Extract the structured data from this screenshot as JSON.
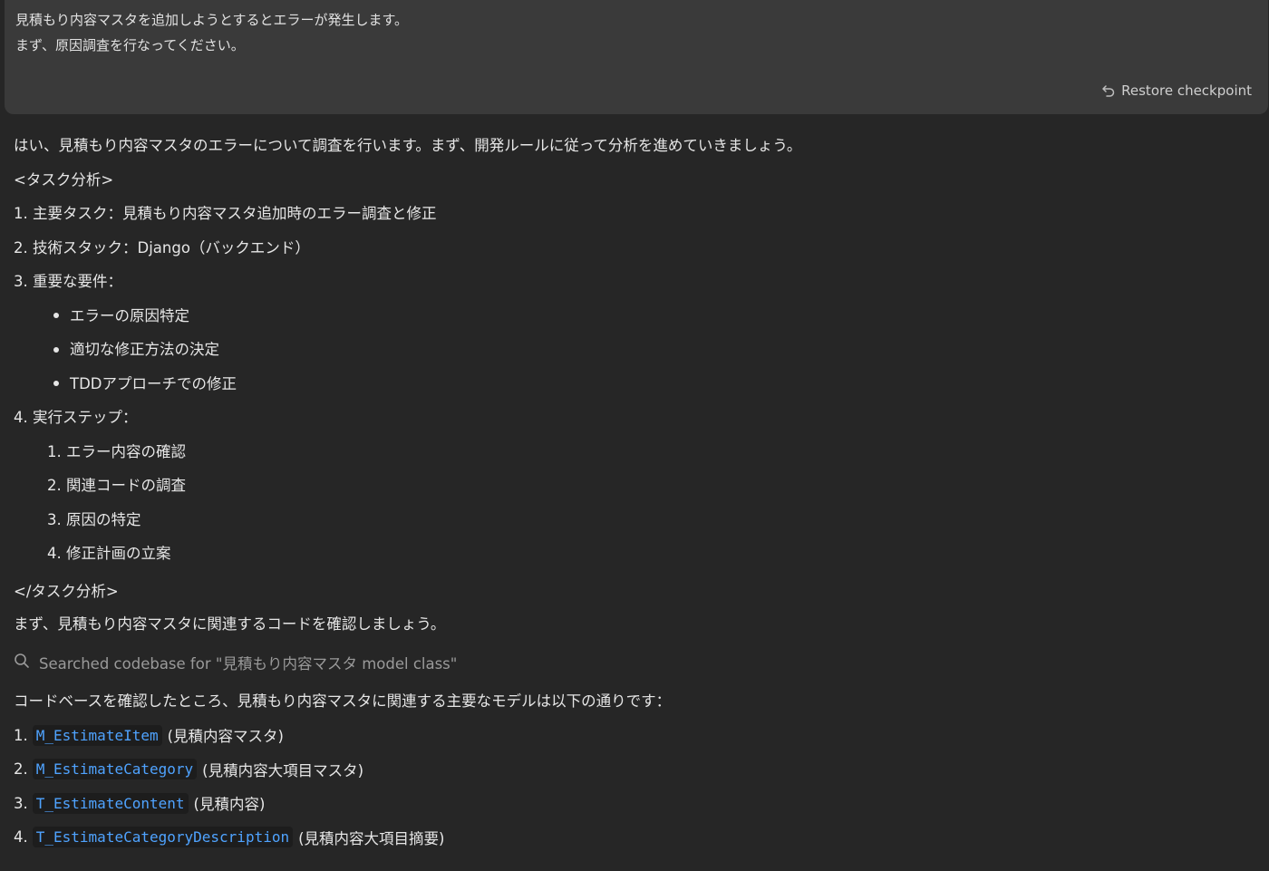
{
  "user_message": {
    "lines": [
      "見積もり内容マスタを追加しようとするとエラーが発生します。",
      "まず、原因調査を行なってください。"
    ],
    "restore_label": "Restore checkpoint"
  },
  "assistant": {
    "intro": "はい、見積もり内容マスタのエラーについて調査を行います。まず、開発ルールに従って分析を進めていきましょう。",
    "task_open": "<タスク分析>",
    "items": [
      "1. 主要タスク：見積もり内容マスタ追加時のエラー調査と修正",
      "2. 技術スタック：Django（バックエンド）",
      "3. 重要な要件："
    ],
    "requirements": [
      "エラーの原因特定",
      "適切な修正方法の決定",
      "TDDアプローチでの修正"
    ],
    "steps_heading": "4. 実行ステップ：",
    "steps": [
      "1. エラー内容の確認",
      "2. 関連コードの調査",
      "3. 原因の特定",
      "4. 修正計画の立案"
    ],
    "task_close": "</タスク分析>",
    "next": "まず、見積もり内容マスタに関連するコードを確認しましょう。",
    "search_text": "Searched codebase for \"見積もり内容マスタ model class\"",
    "result_intro": "コードベースを確認したところ、見積もり内容マスタに関連する主要なモデルは以下の通りです：",
    "models": [
      {
        "num": "1.",
        "code": "M_EstimateItem",
        "desc": "(見積内容マスタ)"
      },
      {
        "num": "2.",
        "code": "M_EstimateCategory",
        "desc": "(見積内容大項目マスタ)"
      },
      {
        "num": "3.",
        "code": "T_EstimateContent",
        "desc": "(見積内容)"
      },
      {
        "num": "4.",
        "code": "T_EstimateCategoryDescription",
        "desc": "(見積内容大項目摘要)"
      }
    ]
  },
  "icons": {
    "restore": "undo-arrow-icon",
    "search": "search-icon"
  },
  "colors": {
    "background": "#262626",
    "user_bubble": "#3a3a3a",
    "code_text": "#4fa3ff",
    "muted_text": "#9a9a9a"
  }
}
